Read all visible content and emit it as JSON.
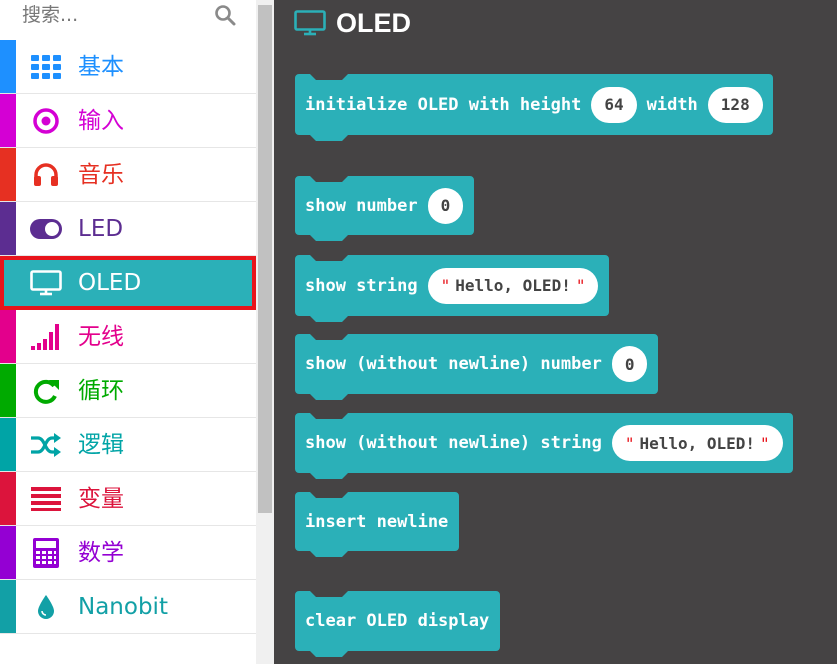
{
  "search": {
    "placeholder": "搜索..."
  },
  "categories": [
    {
      "label": "基本",
      "color": "#1e90ff",
      "icon": "grid-icon"
    },
    {
      "label": "输入",
      "color": "#d400d4",
      "icon": "target-icon"
    },
    {
      "label": "音乐",
      "color": "#e63022",
      "icon": "headphones-icon"
    },
    {
      "label": "LED",
      "color": "#5c2d91",
      "icon": "toggle-icon"
    },
    {
      "label": "OLED",
      "color": "#2bb0b8",
      "icon": "monitor-icon"
    },
    {
      "label": "无线",
      "color": "#e3008c",
      "icon": "signal-icon"
    },
    {
      "label": "循环",
      "color": "#00aa00",
      "icon": "loop-icon"
    },
    {
      "label": "逻辑",
      "color": "#00a4a6",
      "icon": "shuffle-icon"
    },
    {
      "label": "变量",
      "color": "#dc143c",
      "icon": "list-icon"
    },
    {
      "label": "数学",
      "color": "#9400d3",
      "icon": "calculator-icon"
    },
    {
      "label": "Nanobit",
      "color": "#12a0a6",
      "icon": "drop-icon"
    }
  ],
  "flyout": {
    "title": "OLED",
    "block_color": "#2bb0b8",
    "blocks": {
      "init": {
        "t1": "initialize OLED with height",
        "v1": "64",
        "t2": "width",
        "v2": "128"
      },
      "show_number": {
        "t1": "show number",
        "v1": "0"
      },
      "show_string": {
        "t1": "show string",
        "v1": "Hello, OLED!"
      },
      "show_number_nonl": {
        "t1": "show (without newline) number",
        "v1": "0"
      },
      "show_string_nonl": {
        "t1": "show (without newline) string",
        "v1": "Hello, OLED!"
      },
      "insert_newline": {
        "t1": "insert newline"
      },
      "clear_display": {
        "t1": "clear OLED display"
      }
    }
  }
}
